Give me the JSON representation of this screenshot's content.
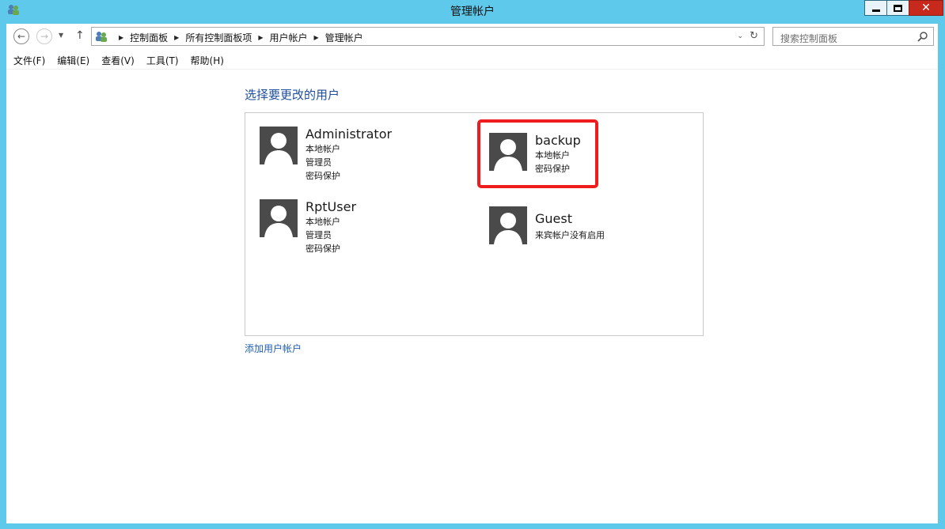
{
  "window": {
    "title": "管理帐户",
    "minimize_label": "",
    "maximize_label": "",
    "close_label": "✕"
  },
  "address": {
    "crumbs": [
      "控制面板",
      "所有控制面板项",
      "用户帐户",
      "管理帐户"
    ]
  },
  "search": {
    "placeholder": "搜索控制面板"
  },
  "menu": [
    "文件(F)",
    "编辑(E)",
    "查看(V)",
    "工具(T)",
    "帮助(H)"
  ],
  "main": {
    "heading": "选择要更改的用户",
    "add_account_link": "添加用户帐户"
  },
  "users": [
    {
      "name": "Administrator",
      "lines": [
        "本地帐户",
        "管理员",
        "密码保护"
      ]
    },
    {
      "name": "backup",
      "lines": [
        "本地帐户",
        "密码保护"
      ],
      "highlighted": true
    },
    {
      "name": "RptUser",
      "lines": [
        "本地帐户",
        "管理员",
        "密码保护"
      ]
    },
    {
      "name": "Guest",
      "lines": [
        "来宾帐户没有启用"
      ]
    }
  ],
  "colors": {
    "accent_heading": "#1f4e9e",
    "highlight_border": "#ee1c1c",
    "window_frame": "#5ec9ea",
    "close_button": "#c7291c"
  }
}
